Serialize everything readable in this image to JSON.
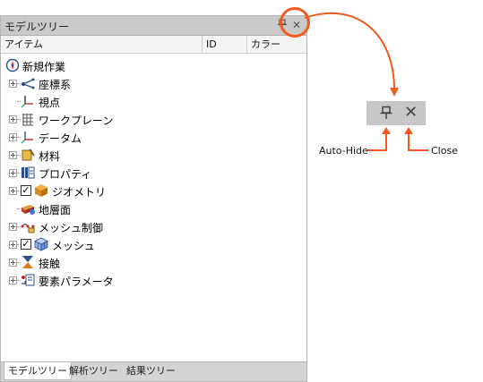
{
  "panel": {
    "title": "モデルツリー",
    "pin_glyph": "⊓",
    "close_glyph": "✕"
  },
  "columns": {
    "item": "アイテム",
    "id": "ID",
    "color": "カラー"
  },
  "tree": {
    "root": "新規作業",
    "items": [
      {
        "label": "座標系",
        "icon": "coordinate-system-icon",
        "expandable": true,
        "checkbox": false
      },
      {
        "label": "視点",
        "icon": "viewpoint-icon",
        "expandable": false,
        "checkbox": false
      },
      {
        "label": "ワークプレーン",
        "icon": "workplane-grid-icon",
        "expandable": true,
        "checkbox": false
      },
      {
        "label": "データム",
        "icon": "datum-axes-icon",
        "expandable": true,
        "checkbox": false
      },
      {
        "label": "材料",
        "icon": "material-icon",
        "expandable": true,
        "checkbox": false
      },
      {
        "label": "プロパティ",
        "icon": "property-icon",
        "expandable": true,
        "checkbox": false
      },
      {
        "label": "ジオメトリ",
        "icon": "geometry-box-icon",
        "expandable": true,
        "checkbox": true,
        "checked": "✓"
      },
      {
        "label": "地層面",
        "icon": "ground-surface-icon",
        "expandable": false,
        "checkbox": false
      },
      {
        "label": "メッシュ制御",
        "icon": "mesh-control-icon",
        "expandable": true,
        "checkbox": false
      },
      {
        "label": "メッシュ",
        "icon": "mesh-icon",
        "expandable": true,
        "checkbox": true,
        "checked": "✓"
      },
      {
        "label": "接触",
        "icon": "contact-icon",
        "expandable": true,
        "checkbox": false
      },
      {
        "label": "要素パラメータ",
        "icon": "element-parameter-icon",
        "expandable": true,
        "checkbox": false
      }
    ]
  },
  "tabs": [
    {
      "label": "モデルツリー",
      "active": true
    },
    {
      "label": "解析ツリー",
      "active": false
    },
    {
      "label": "結果ツリー",
      "active": false
    }
  ],
  "callout": {
    "auto_hide": "Auto-Hide",
    "close": "Close",
    "accent": "#f25a1e"
  }
}
